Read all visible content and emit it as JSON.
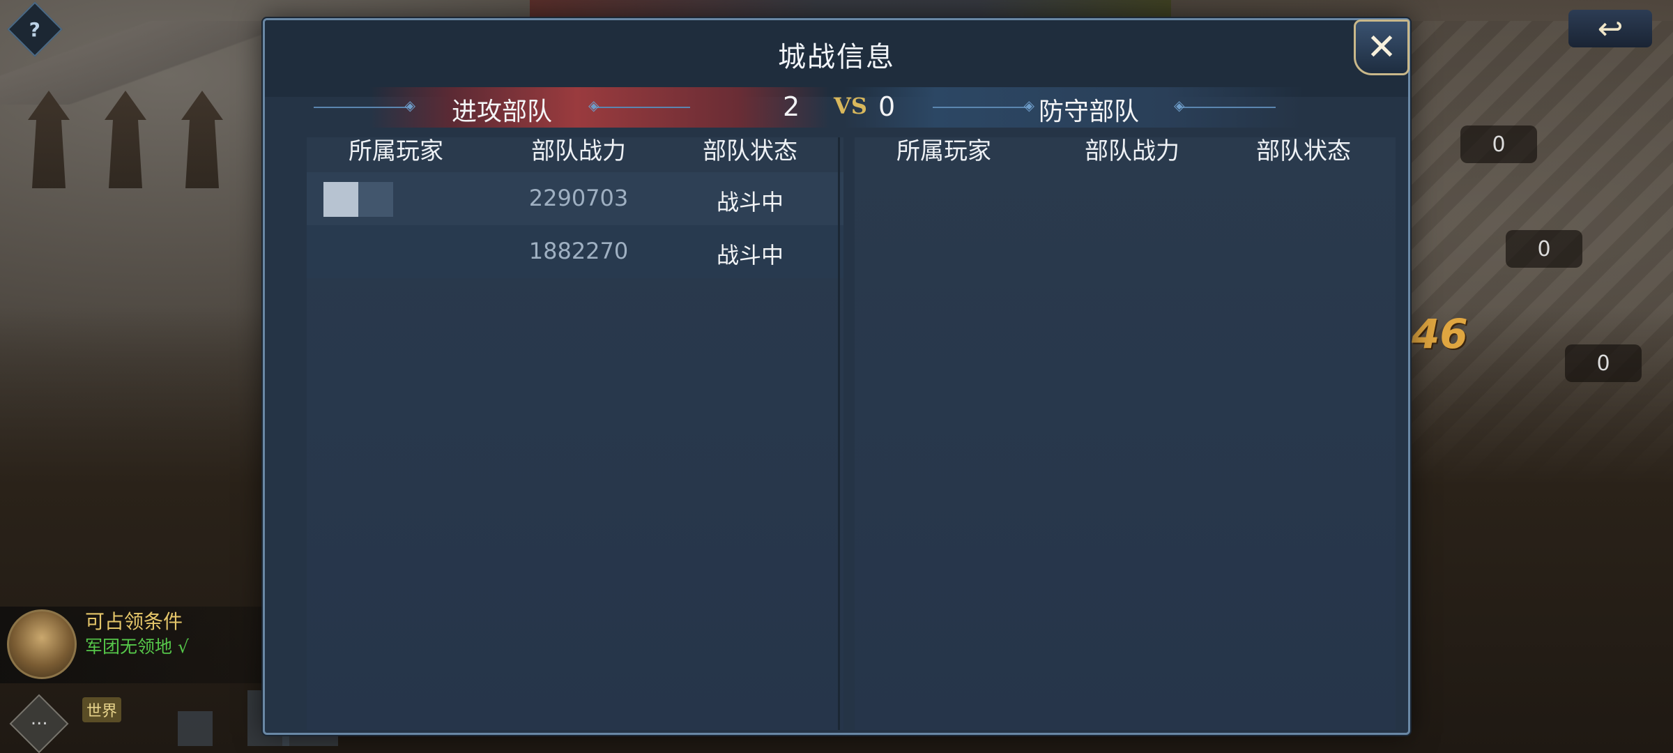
{
  "dialog": {
    "title": "城战信息",
    "close_label": "✕"
  },
  "versus": {
    "attack_label": "进攻部队",
    "defense_label": "防守部队",
    "attack_count": "2",
    "vs_label": "VS",
    "defense_count": "0"
  },
  "attack_table": {
    "headers": [
      "所属玩家",
      "部队战力",
      "部队状态"
    ],
    "rows": [
      {
        "player": "",
        "power": "2290703",
        "status": "战斗中"
      },
      {
        "player": "",
        "power": "1882270",
        "status": "战斗中"
      }
    ]
  },
  "defense_table": {
    "headers": [
      "所属玩家",
      "部队战力",
      "部队状态"
    ],
    "rows": []
  },
  "hud": {
    "help_label": "?",
    "side_scores": [
      "0",
      "0",
      "0"
    ],
    "big_number": "46",
    "occupy_title": "可占领条件",
    "occupy_condition": "军团无领地 √",
    "chat_tag": "世界",
    "chat_icon": "···",
    "back_icon": "↩"
  }
}
